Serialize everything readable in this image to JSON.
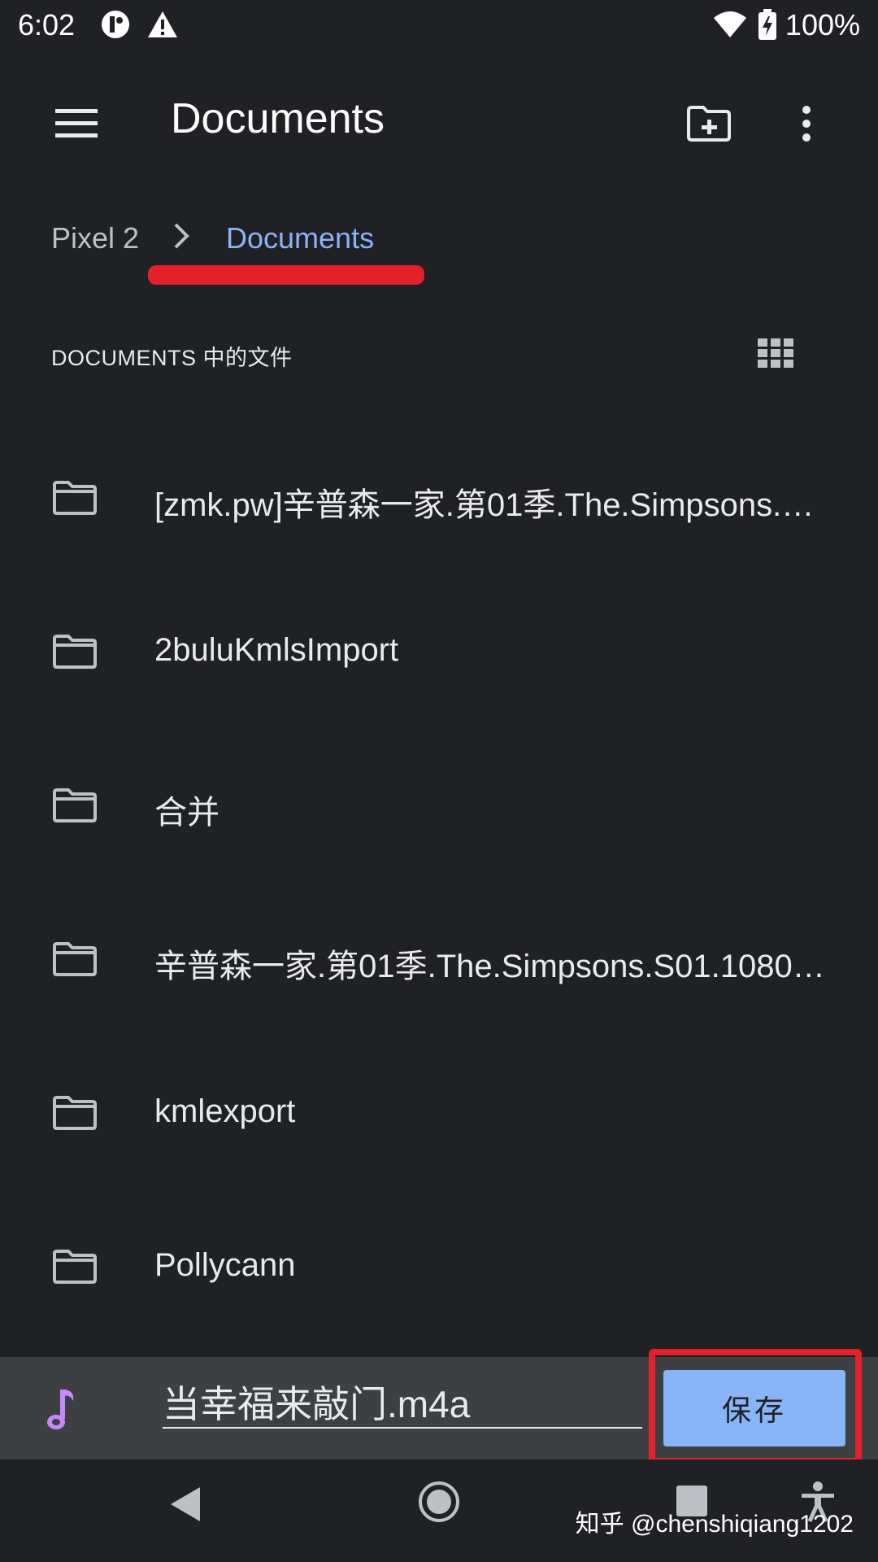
{
  "status_bar": {
    "time": "6:02",
    "battery": "100%"
  },
  "toolbar": {
    "title": "Documents",
    "menu_icon": "menu-icon",
    "new_folder_icon": "create-folder-icon",
    "overflow_icon": "more-vert-icon"
  },
  "breadcrumb": {
    "root": "Pixel 2",
    "current": "Documents"
  },
  "section": {
    "header": "DOCUMENTS 中的文件",
    "grid_icon": "grid-view-icon"
  },
  "files": [
    {
      "name": "[zmk.pw]辛普森一家.第01季.The.Simpsons.…",
      "icon": "folder-icon"
    },
    {
      "name": "2buluKmlsImport",
      "icon": "folder-icon"
    },
    {
      "name": "合并",
      "icon": "folder-icon"
    },
    {
      "name": "辛普森一家.第01季.The.Simpsons.S01.1080…",
      "icon": "folder-icon"
    },
    {
      "name": "kmlexport",
      "icon": "folder-icon"
    },
    {
      "name": "Pollycann",
      "icon": "folder-icon"
    }
  ],
  "save_bar": {
    "filename": "当幸福来敲门.m4a",
    "save_label": "保存",
    "file_icon": "music-note-icon"
  },
  "colors": {
    "background": "#202124",
    "accent": "#8ab4f8",
    "highlight": "#e3212a",
    "music_icon": "#c58af9"
  },
  "watermark": "知乎 @chenshiqiang1202"
}
